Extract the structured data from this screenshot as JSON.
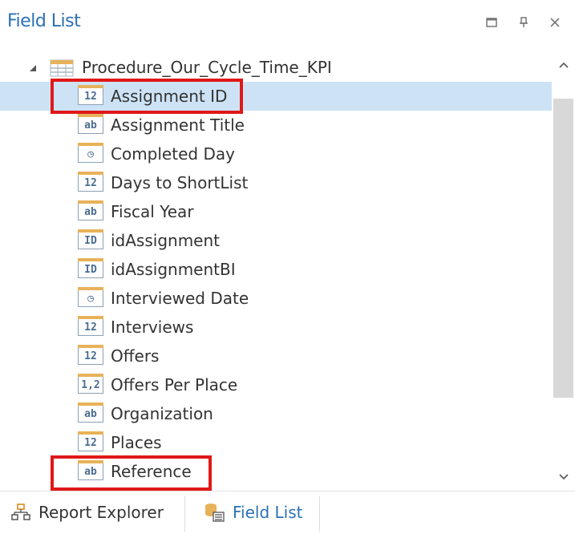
{
  "panel": {
    "title": "Field List",
    "buttons": {
      "maximize_icon": "maximize-icon",
      "pin_icon": "pin-icon",
      "close_icon": "close-icon"
    }
  },
  "tree": {
    "root_label": "Procedure_Our_Cycle_Time_KPI",
    "fields": [
      {
        "label": "Assignment ID",
        "type_badge": "12",
        "selected": true,
        "highlighted": true
      },
      {
        "label": "Assignment Title",
        "type_badge": "ab",
        "selected": false,
        "highlighted": false
      },
      {
        "label": "Completed Day",
        "type_badge": "◷",
        "selected": false,
        "highlighted": false
      },
      {
        "label": "Days to ShortList",
        "type_badge": "12",
        "selected": false,
        "highlighted": false
      },
      {
        "label": "Fiscal Year",
        "type_badge": "ab",
        "selected": false,
        "highlighted": false
      },
      {
        "label": "idAssignment",
        "type_badge": "ID",
        "selected": false,
        "highlighted": false
      },
      {
        "label": "idAssignmentBI",
        "type_badge": "ID",
        "selected": false,
        "highlighted": false
      },
      {
        "label": "Interviewed Date",
        "type_badge": "◷",
        "selected": false,
        "highlighted": false
      },
      {
        "label": "Interviews",
        "type_badge": "12",
        "selected": false,
        "highlighted": false
      },
      {
        "label": "Offers",
        "type_badge": "12",
        "selected": false,
        "highlighted": false
      },
      {
        "label": "Offers Per Place",
        "type_badge": "1,2",
        "selected": false,
        "highlighted": false
      },
      {
        "label": "Organization",
        "type_badge": "ab",
        "selected": false,
        "highlighted": false
      },
      {
        "label": "Places",
        "type_badge": "12",
        "selected": false,
        "highlighted": false
      },
      {
        "label": "Reference",
        "type_badge": "ab",
        "selected": false,
        "highlighted": true
      }
    ]
  },
  "footer": {
    "tabs": [
      {
        "label": "Report Explorer",
        "icon": "report-explorer-icon",
        "active": false
      },
      {
        "label": "Field List",
        "icon": "field-list-icon",
        "active": true
      }
    ]
  },
  "colors": {
    "accent": "#2c71b5",
    "selection": "#cde3f5",
    "highlight_border": "#e01818"
  }
}
